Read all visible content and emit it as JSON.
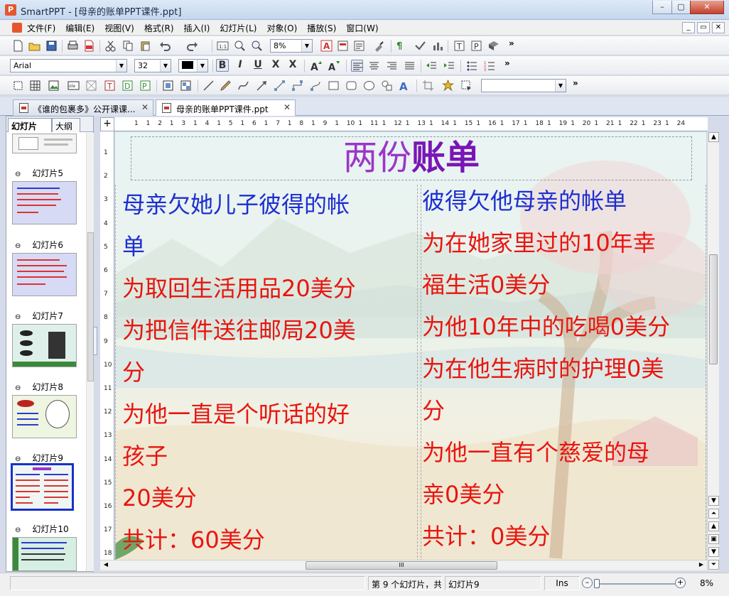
{
  "window": {
    "app_name": "SmartPPT",
    "title": "SmartPPT - [母亲的账单PPT课件.ppt]",
    "min_label": "–",
    "max_label": "▢",
    "close_label": "✕"
  },
  "menu": {
    "items": [
      "文件(F)",
      "编辑(E)",
      "视图(V)",
      "格式(R)",
      "插入(I)",
      "幻灯片(L)",
      "对象(O)",
      "播放(S)",
      "窗口(W)"
    ],
    "mdi_min": "_",
    "mdi_restore": "▭",
    "mdi_close": "✕"
  },
  "toolbar1": {
    "zoom_value": "8%",
    "more": "»"
  },
  "toolbar2": {
    "font_name": "Arial",
    "font_size": "32",
    "bold": "B",
    "italic": "I",
    "underline": "U",
    "strike": "X",
    "shadow": "X",
    "more": "»"
  },
  "toolbar3": {
    "style_value": "",
    "more": "»"
  },
  "doc_tabs": [
    {
      "label": "《谁的包裹多》公开课课...",
      "close": "✕"
    },
    {
      "label": "母亲的账单PPT课件.ppt",
      "close": "✕"
    }
  ],
  "panel": {
    "tab_slides": "幻灯片",
    "tab_outline": "大纲",
    "thumbs": [
      {
        "label": "幻灯片5"
      },
      {
        "label": "幻灯片6"
      },
      {
        "label": "幻灯片7"
      },
      {
        "label": "幻灯片8"
      },
      {
        "label": "幻灯片9"
      },
      {
        "label": "幻灯片10"
      }
    ]
  },
  "ruler": {
    "h_numbers": [
      "1",
      "1",
      "2",
      "1",
      "3",
      "1",
      "4",
      "1",
      "5",
      "1",
      "6",
      "1",
      "7",
      "1",
      "8",
      "1",
      "9",
      "1",
      "10",
      "1",
      "11",
      "1",
      "12",
      "1",
      "13",
      "1",
      "14",
      "1",
      "15",
      "1",
      "16",
      "1",
      "17",
      "1",
      "18",
      "1",
      "19",
      "1",
      "20",
      "1",
      "21",
      "1",
      "22",
      "1",
      "23",
      "1",
      "24"
    ],
    "v_numbers": [
      "1",
      "2",
      "3",
      "4",
      "5",
      "6",
      "7",
      "8",
      "9",
      "10",
      "11",
      "12",
      "13",
      "14",
      "15",
      "16",
      "17",
      "18"
    ],
    "corner": "+"
  },
  "slide": {
    "title_part1": "两份",
    "title_part2": "账单",
    "left_lines": [
      {
        "text": "母亲欠她儿子彼得的帐",
        "color": "blue"
      },
      {
        "text": "单",
        "color": "blue"
      },
      {
        "text": "为取回生活用品20美分",
        "color": "red"
      },
      {
        "text": "为把信件送往邮局20美",
        "color": "red"
      },
      {
        "text": "分",
        "color": "red"
      },
      {
        "text": "为他一直是个听话的好",
        "color": "red"
      },
      {
        "text": "孩子",
        "color": "red"
      },
      {
        "text": "20美分",
        "color": "red"
      },
      {
        "text": "共计：60美分",
        "color": "red"
      }
    ],
    "right_lines": [
      {
        "text": "彼得欠他母亲的帐单",
        "color": "blue"
      },
      {
        "text": "为在她家里过的10年幸",
        "color": "red"
      },
      {
        "text": "福生活0美分",
        "color": "red"
      },
      {
        "text": "为他10年中的吃喝0美分",
        "color": "red"
      },
      {
        "text": "为在他生病时的护理0美",
        "color": "red"
      },
      {
        "text": "分",
        "color": "red"
      },
      {
        "text": "为他一直有个慈爱的母",
        "color": "red"
      },
      {
        "text": "亲0美分",
        "color": "red"
      },
      {
        "text": "共计：0美分",
        "color": "red"
      }
    ]
  },
  "hscroll": {
    "grip": "III"
  },
  "status": {
    "slide_info": "第 9 个幻灯片，共",
    "slide_name": "幻灯片9",
    "ins": "Ins",
    "zoom": "8%",
    "zoom_minus": "–",
    "zoom_plus": "+"
  },
  "colors": {
    "title_purple": "#9b36c8",
    "heading_blue": "#1d2fd0",
    "body_red": "#e8150f",
    "selection_blue": "#1a30c8"
  }
}
